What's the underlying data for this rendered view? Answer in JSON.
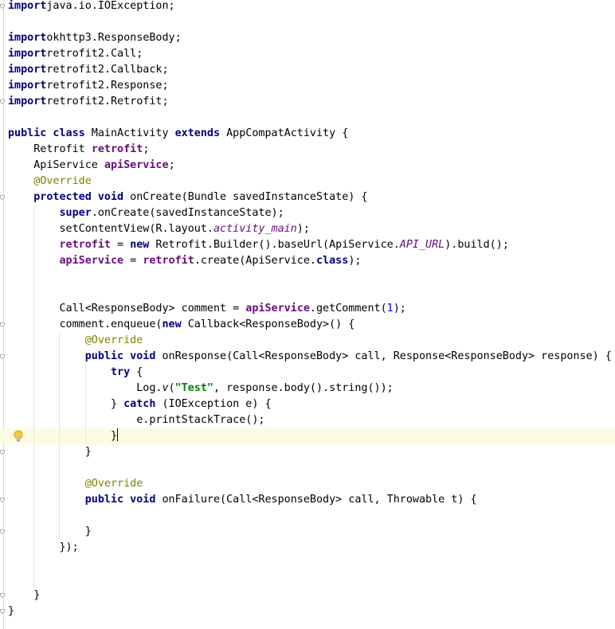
{
  "editor": {
    "colors": {
      "keyword": "#000080",
      "field": "#660e7a",
      "annotation": "#808000",
      "string": "#008000",
      "number": "#0000ff",
      "current_line": "#fdfbe2"
    },
    "intention_icon": "lightbulb-icon",
    "fold_icon": "fold-marker-icon",
    "lines": [
      {
        "tokens": [
          [
            "kw",
            "import"
          ],
          [
            "",
            "java.io.IOException;"
          ]
        ]
      },
      {
        "tokens": []
      },
      {
        "tokens": [
          [
            "kw",
            "import"
          ],
          [
            "",
            "okhttp3.ResponseBody;"
          ]
        ]
      },
      {
        "tokens": [
          [
            "kw",
            "import"
          ],
          [
            "",
            "retrofit2.Call;"
          ]
        ]
      },
      {
        "tokens": [
          [
            "kw",
            "import"
          ],
          [
            "",
            "retrofit2.Callback;"
          ]
        ]
      },
      {
        "tokens": [
          [
            "kw",
            "import"
          ],
          [
            "",
            "retrofit2.Response;"
          ]
        ]
      },
      {
        "tokens": [
          [
            "kw",
            "import"
          ],
          [
            "",
            "retrofit2.Retrofit;"
          ]
        ]
      },
      {
        "tokens": []
      },
      {
        "tokens": [
          [
            "kw",
            "public class"
          ],
          [
            "",
            " MainActivity "
          ],
          [
            "kw",
            "extends"
          ],
          [
            "",
            " AppCompatActivity {"
          ]
        ]
      },
      {
        "tokens": [
          [
            "",
            "    Retrofit "
          ],
          [
            "fld",
            "retrofit"
          ],
          [
            "",
            ";"
          ]
        ]
      },
      {
        "tokens": [
          [
            "",
            "    ApiService "
          ],
          [
            "fld",
            "apiService"
          ],
          [
            "",
            ";"
          ]
        ]
      },
      {
        "tokens": [
          [
            "",
            "    "
          ],
          [
            "ann",
            "@Override"
          ]
        ]
      },
      {
        "tokens": [
          [
            "",
            "    "
          ],
          [
            "kw",
            "protected void"
          ],
          [
            "",
            " onCreate(Bundle savedInstanceState) {"
          ]
        ]
      },
      {
        "tokens": [
          [
            "",
            "        "
          ],
          [
            "kw",
            "super"
          ],
          [
            "",
            ".onCreate(savedInstanceState);"
          ]
        ]
      },
      {
        "tokens": [
          [
            "",
            "        setContentView(R.layout."
          ],
          [
            "ist",
            "activity_main"
          ],
          [
            "",
            ");"
          ]
        ]
      },
      {
        "tokens": [
          [
            "",
            "        "
          ],
          [
            "fld",
            "retrofit"
          ],
          [
            "",
            " = "
          ],
          [
            "kw",
            "new"
          ],
          [
            "",
            " Retrofit.Builder().baseUrl(ApiService."
          ],
          [
            "ist",
            "API_URL"
          ],
          [
            "",
            ").build();"
          ]
        ]
      },
      {
        "tokens": [
          [
            "",
            "        "
          ],
          [
            "fld",
            "apiService"
          ],
          [
            "",
            " = "
          ],
          [
            "fld",
            "retrofit"
          ],
          [
            "",
            ".create(ApiService."
          ],
          [
            "kw",
            "class"
          ],
          [
            "",
            ");"
          ]
        ]
      },
      {
        "tokens": []
      },
      {
        "tokens": []
      },
      {
        "tokens": [
          [
            "",
            "        Call<ResponseBody> comment = "
          ],
          [
            "fld",
            "apiService"
          ],
          [
            "",
            ".getComment("
          ],
          [
            "num",
            "1"
          ],
          [
            "",
            ");"
          ]
        ]
      },
      {
        "tokens": [
          [
            "",
            "        comment.enqueue("
          ],
          [
            "kw",
            "new"
          ],
          [
            "",
            " Callback<ResponseBody>() {"
          ]
        ]
      },
      {
        "tokens": [
          [
            "",
            "            "
          ],
          [
            "ann",
            "@Override"
          ]
        ]
      },
      {
        "tokens": [
          [
            "",
            "            "
          ],
          [
            "kw",
            "public void"
          ],
          [
            "",
            " onResponse(Call<ResponseBody> call, Response<ResponseBody> response) {"
          ]
        ]
      },
      {
        "tokens": [
          [
            "",
            "                "
          ],
          [
            "kw",
            "try"
          ],
          [
            "",
            " {"
          ]
        ]
      },
      {
        "tokens": [
          [
            "",
            "                    Log."
          ],
          [
            "ic",
            "v"
          ],
          [
            "",
            "("
          ],
          [
            "str",
            "\"Test\""
          ],
          [
            "",
            ", response.body().string());"
          ]
        ]
      },
      {
        "tokens": [
          [
            "",
            "                } "
          ],
          [
            "kw",
            "catch"
          ],
          [
            "",
            " (IOException e) {"
          ]
        ]
      },
      {
        "tokens": [
          [
            "",
            "                    e.printStackTrace();"
          ]
        ]
      },
      {
        "tokens": [
          [
            "",
            "                }"
          ]
        ],
        "current": true
      },
      {
        "tokens": [
          [
            "",
            "            }"
          ]
        ]
      },
      {
        "tokens": []
      },
      {
        "tokens": [
          [
            "",
            "            "
          ],
          [
            "ann",
            "@Override"
          ]
        ]
      },
      {
        "tokens": [
          [
            "",
            "            "
          ],
          [
            "kw",
            "public void"
          ],
          [
            "",
            " onFailure(Call<ResponseBody> call, Throwable t) {"
          ]
        ]
      },
      {
        "tokens": []
      },
      {
        "tokens": [
          [
            "",
            "            }"
          ]
        ]
      },
      {
        "tokens": [
          [
            "",
            "        });"
          ]
        ]
      },
      {
        "tokens": []
      },
      {
        "tokens": []
      },
      {
        "tokens": [
          [
            "",
            "    }"
          ]
        ]
      },
      {
        "tokens": [
          [
            "",
            "}"
          ]
        ]
      }
    ]
  }
}
